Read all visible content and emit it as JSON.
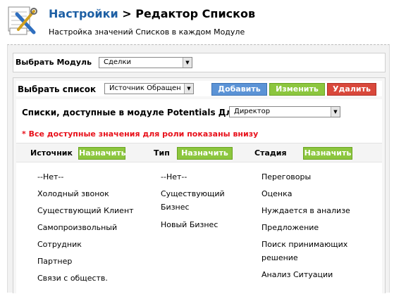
{
  "header": {
    "crumb_link": "Настройки",
    "crumb_sep": " > ",
    "crumb_current": "Редактор Списков",
    "subtitle": "Настройка значений Списков в каждом Модуле"
  },
  "module_bar": {
    "label": "Выбрать Модуль",
    "selected": "Сделки"
  },
  "list_bar": {
    "label": "Выбрать список",
    "selected": "Источник Обращен",
    "add_label": "Добавить",
    "edit_label": "Изменить",
    "delete_label": "Удалить"
  },
  "role_bar": {
    "label": "Списки, доступные в модуле Potentials Для",
    "selected": "Директор",
    "warning": "* Все доступные значения для роли показаны внизу"
  },
  "columns": [
    {
      "title": "Источник",
      "assign_label": "Назначить",
      "items": [
        "--Нет--",
        "Холодный звонок",
        "Существующий Клиент",
        "Самопроизвольный",
        "Сотрудник",
        "Партнер",
        "Связи с обществ."
      ]
    },
    {
      "title": "Тип",
      "assign_label": "Назначить",
      "items": [
        "--Нет--",
        "Существующий",
        "Бизнес",
        "Новый Бизнес"
      ]
    },
    {
      "title": "Стадия",
      "assign_label": "Назначить",
      "items": [
        "Переговоры",
        "Оценка",
        "Нуждается в анализе",
        "Предложение",
        "Поиск принимающих",
        "решение",
        "Анализ Ситуации"
      ]
    }
  ],
  "colors": {
    "link": "#1d5fa4",
    "add": "#5b93d6",
    "edit": "#8cc63e",
    "delete": "#d9483b",
    "warning": "#e8101a"
  }
}
